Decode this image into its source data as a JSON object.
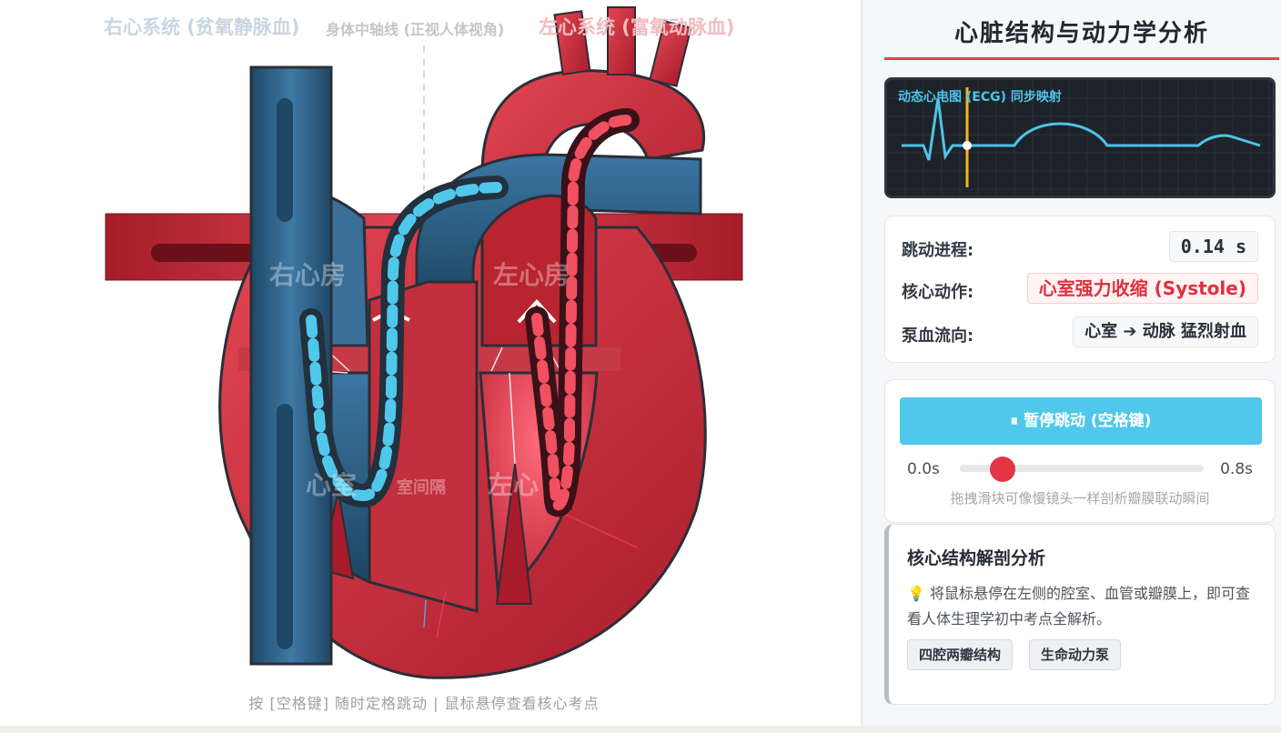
{
  "stage": {
    "header_right": "右心系统 (贫氧静脉血)",
    "header_mid": "身体中轴线 (正视人体视角)",
    "header_left": "左心系统 (富氧动脉血)",
    "wm_ra": "右心房",
    "wm_la": "左心房",
    "wm_rv": "心室",
    "wm_septum": "室间隔",
    "wm_lv": "左心",
    "footer": "按 [空格键] 随时定格跳动 | 鼠标悬停查看核心考点"
  },
  "panel": {
    "title": "心脏结构与动力学分析",
    "ecg_label": "动态心电图 (ECG) 同步映射",
    "status": {
      "progress_label": "跳动进程:",
      "progress_value": "0.14 s",
      "action_label": "核心动作:",
      "action_value": "心室强力收缩 (Systole)",
      "flow_label": "泵血流向:",
      "flow_value": "心室 ➔ 动脉 猛烈射血"
    },
    "controls": {
      "play_label": "⏸ 暂停跳动 (空格键)",
      "time_min": "0.0s",
      "time_max": "0.8s",
      "slider_fraction": 0.175,
      "hint": "拖拽滑块可像慢镜头一样剖析瓣膜联动瞬间"
    },
    "info": {
      "title": "核心结构解剖分析",
      "body": "💡 将鼠标悬停在左侧的腔室、血管或瓣膜上，即可查看人体生理学初中考点全解析。",
      "tags": [
        "四腔两瓣结构",
        "生命动力泵"
      ]
    }
  },
  "colors": {
    "accent_red": "#e3424f",
    "accent_blue": "#4fc8eb",
    "venous": "#2d5f86",
    "arterial": "#c8303d"
  }
}
